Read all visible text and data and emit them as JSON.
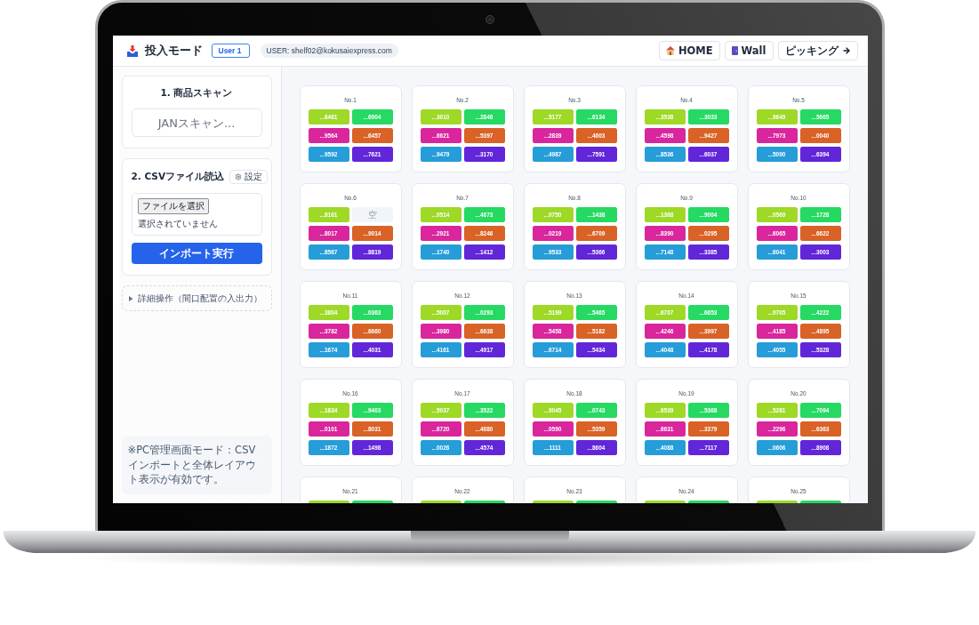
{
  "header": {
    "title": "投入モード",
    "user_badge": "User 1",
    "user_email": "USER: shelf02@kokusaiexpress.com",
    "nav_buttons": [
      {
        "label": "HOME",
        "kind": "home"
      },
      {
        "label": "Wall",
        "kind": "wall"
      },
      {
        "label": "ピッキング",
        "kind": "forward"
      }
    ]
  },
  "sidebar": {
    "scan_panel": {
      "heading": "1. 商品スキャン",
      "input": {
        "placeholder": "JANスキャン..."
      }
    },
    "csv_panel": {
      "heading": "2. CSVファイル読込",
      "settings_button": "設定",
      "file_button": "ファイルを選択",
      "file_status": "選択されていません",
      "import_button": "インポート実行"
    },
    "details": {
      "label": "詳細操作（間口配置の入出力）",
      "expanded": false
    },
    "note": "※PC管理画面モード：CSVインポートと全体レイアウト表示が有効です。"
  },
  "shelves": [
    {
      "label": "No.1",
      "slots": [
        {
          "kind": "filled",
          "text": "...6461",
          "color": "#9dd926"
        },
        {
          "kind": "filled",
          "text": "...6904",
          "color": "#26d962"
        },
        {
          "kind": "filled",
          "text": "...9564",
          "color": "#d9269d"
        },
        {
          "kind": "filled",
          "text": "...6457",
          "color": "#d96226"
        },
        {
          "kind": "filled",
          "text": "...9592",
          "color": "#269dd9"
        },
        {
          "kind": "filled",
          "text": "...7621",
          "color": "#6226d9"
        }
      ]
    },
    {
      "label": "No.2",
      "slots": [
        {
          "kind": "filled",
          "text": "...3010",
          "color": "#9dd926"
        },
        {
          "kind": "filled",
          "text": "...2846",
          "color": "#26d962"
        },
        {
          "kind": "filled",
          "text": "...6621",
          "color": "#d9269d"
        },
        {
          "kind": "filled",
          "text": "...5397",
          "color": "#d96226"
        },
        {
          "kind": "filled",
          "text": "...9479",
          "color": "#269dd9"
        },
        {
          "kind": "filled",
          "text": "...3170",
          "color": "#6226d9"
        }
      ]
    },
    {
      "label": "No.3",
      "slots": [
        {
          "kind": "filled",
          "text": "...5177",
          "color": "#9dd926"
        },
        {
          "kind": "filled",
          "text": "...6134",
          "color": "#26d962"
        },
        {
          "kind": "filled",
          "text": "...2839",
          "color": "#d9269d"
        },
        {
          "kind": "filled",
          "text": "...4603",
          "color": "#d96226"
        },
        {
          "kind": "filled",
          "text": "...4987",
          "color": "#269dd9"
        },
        {
          "kind": "filled",
          "text": "...7591",
          "color": "#6226d9"
        }
      ]
    },
    {
      "label": "No.4",
      "slots": [
        {
          "kind": "filled",
          "text": "...3538",
          "color": "#9dd926"
        },
        {
          "kind": "filled",
          "text": "...3033",
          "color": "#26d962"
        },
        {
          "kind": "filled",
          "text": "...4598",
          "color": "#d9269d"
        },
        {
          "kind": "filled",
          "text": "...9427",
          "color": "#d96226"
        },
        {
          "kind": "filled",
          "text": "...8536",
          "color": "#269dd9"
        },
        {
          "kind": "filled",
          "text": "...6037",
          "color": "#6226d9"
        }
      ]
    },
    {
      "label": "No.5",
      "slots": [
        {
          "kind": "filled",
          "text": "...9649",
          "color": "#9dd926"
        },
        {
          "kind": "filled",
          "text": "...5665",
          "color": "#26d962"
        },
        {
          "kind": "filled",
          "text": "...7973",
          "color": "#d9269d"
        },
        {
          "kind": "filled",
          "text": "...0040",
          "color": "#d96226"
        },
        {
          "kind": "filled",
          "text": "...5090",
          "color": "#269dd9"
        },
        {
          "kind": "filled",
          "text": "...6394",
          "color": "#6226d9"
        }
      ]
    },
    {
      "label": "No.6",
      "slots": [
        {
          "kind": "filled",
          "text": "...8161",
          "color": "#9dd926"
        },
        {
          "kind": "empty",
          "text": "空"
        },
        {
          "kind": "filled",
          "text": "...8017",
          "color": "#d9269d"
        },
        {
          "kind": "filled",
          "text": "...9014",
          "color": "#d96226"
        },
        {
          "kind": "filled",
          "text": "...8567",
          "color": "#269dd9"
        },
        {
          "kind": "filled",
          "text": "...8819",
          "color": "#6226d9"
        }
      ]
    },
    {
      "label": "No.7",
      "slots": [
        {
          "kind": "filled",
          "text": "...0514",
          "color": "#9dd926"
        },
        {
          "kind": "filled",
          "text": "...4673",
          "color": "#26d962"
        },
        {
          "kind": "filled",
          "text": "...2921",
          "color": "#d9269d"
        },
        {
          "kind": "filled",
          "text": "...8246",
          "color": "#d96226"
        },
        {
          "kind": "filled",
          "text": "...1740",
          "color": "#269dd9"
        },
        {
          "kind": "filled",
          "text": "...1412",
          "color": "#6226d9"
        }
      ]
    },
    {
      "label": "No.8",
      "slots": [
        {
          "kind": "filled",
          "text": "...0750",
          "color": "#9dd926"
        },
        {
          "kind": "filled",
          "text": "...1438",
          "color": "#26d962"
        },
        {
          "kind": "filled",
          "text": "...0219",
          "color": "#d9269d"
        },
        {
          "kind": "filled",
          "text": "...6709",
          "color": "#d96226"
        },
        {
          "kind": "filled",
          "text": "...9533",
          "color": "#269dd9"
        },
        {
          "kind": "filled",
          "text": "...5366",
          "color": "#6226d9"
        }
      ]
    },
    {
      "label": "No.9",
      "slots": [
        {
          "kind": "filled",
          "text": "...1368",
          "color": "#9dd926"
        },
        {
          "kind": "filled",
          "text": "...9004",
          "color": "#26d962"
        },
        {
          "kind": "filled",
          "text": "...8390",
          "color": "#d9269d"
        },
        {
          "kind": "filled",
          "text": "...0295",
          "color": "#d96226"
        },
        {
          "kind": "filled",
          "text": "...7148",
          "color": "#269dd9"
        },
        {
          "kind": "filled",
          "text": "...3385",
          "color": "#6226d9"
        }
      ]
    },
    {
      "label": "No.10",
      "slots": [
        {
          "kind": "filled",
          "text": "...0569",
          "color": "#9dd926"
        },
        {
          "kind": "filled",
          "text": "...1728",
          "color": "#26d962"
        },
        {
          "kind": "filled",
          "text": "...6065",
          "color": "#d9269d"
        },
        {
          "kind": "filled",
          "text": "...6622",
          "color": "#d96226"
        },
        {
          "kind": "filled",
          "text": "...6041",
          "color": "#269dd9"
        },
        {
          "kind": "filled",
          "text": "...3003",
          "color": "#6226d9"
        }
      ]
    },
    {
      "label": "No.11",
      "slots": [
        {
          "kind": "filled",
          "text": "...3804",
          "color": "#9dd926"
        },
        {
          "kind": "filled",
          "text": "...0363",
          "color": "#26d962"
        },
        {
          "kind": "filled",
          "text": "...3782",
          "color": "#d9269d"
        },
        {
          "kind": "filled",
          "text": "...6660",
          "color": "#d96226"
        },
        {
          "kind": "filled",
          "text": "...1674",
          "color": "#269dd9"
        },
        {
          "kind": "filled",
          "text": "...4031",
          "color": "#6226d9"
        }
      ]
    },
    {
      "label": "No.12",
      "slots": [
        {
          "kind": "filled",
          "text": "...5007",
          "color": "#9dd926"
        },
        {
          "kind": "filled",
          "text": "...0293",
          "color": "#26d962"
        },
        {
          "kind": "filled",
          "text": "...3980",
          "color": "#d9269d"
        },
        {
          "kind": "filled",
          "text": "...6638",
          "color": "#d96226"
        },
        {
          "kind": "filled",
          "text": "...4161",
          "color": "#269dd9"
        },
        {
          "kind": "filled",
          "text": "...4917",
          "color": "#6226d9"
        }
      ]
    },
    {
      "label": "No.13",
      "slots": [
        {
          "kind": "filled",
          "text": "...5199",
          "color": "#9dd926"
        },
        {
          "kind": "filled",
          "text": "...5465",
          "color": "#26d962"
        },
        {
          "kind": "filled",
          "text": "...5458",
          "color": "#d9269d"
        },
        {
          "kind": "filled",
          "text": "...5182",
          "color": "#d96226"
        },
        {
          "kind": "filled",
          "text": "...6714",
          "color": "#269dd9"
        },
        {
          "kind": "filled",
          "text": "...5434",
          "color": "#6226d9"
        }
      ]
    },
    {
      "label": "No.14",
      "slots": [
        {
          "kind": "filled",
          "text": "...6707",
          "color": "#9dd926"
        },
        {
          "kind": "filled",
          "text": "...6653",
          "color": "#26d962"
        },
        {
          "kind": "filled",
          "text": "...4246",
          "color": "#d9269d"
        },
        {
          "kind": "filled",
          "text": "...3997",
          "color": "#d96226"
        },
        {
          "kind": "filled",
          "text": "...4048",
          "color": "#269dd9"
        },
        {
          "kind": "filled",
          "text": "...4178",
          "color": "#6226d9"
        }
      ]
    },
    {
      "label": "No.15",
      "slots": [
        {
          "kind": "filled",
          "text": "...0705",
          "color": "#9dd926"
        },
        {
          "kind": "filled",
          "text": "...4222",
          "color": "#26d962"
        },
        {
          "kind": "filled",
          "text": "...4185",
          "color": "#d9269d"
        },
        {
          "kind": "filled",
          "text": "...4895",
          "color": "#d96226"
        },
        {
          "kind": "filled",
          "text": "...4055",
          "color": "#269dd9"
        },
        {
          "kind": "filled",
          "text": "...5328",
          "color": "#6226d9"
        }
      ]
    },
    {
      "label": "No.16",
      "slots": [
        {
          "kind": "filled",
          "text": "...1834",
          "color": "#9dd926"
        },
        {
          "kind": "filled",
          "text": "...9403",
          "color": "#26d962"
        },
        {
          "kind": "filled",
          "text": "...0101",
          "color": "#d9269d"
        },
        {
          "kind": "filled",
          "text": "...8031",
          "color": "#d96226"
        },
        {
          "kind": "filled",
          "text": "...1872",
          "color": "#269dd9"
        },
        {
          "kind": "filled",
          "text": "...1498",
          "color": "#6226d9"
        }
      ]
    },
    {
      "label": "No.17",
      "slots": [
        {
          "kind": "filled",
          "text": "...5037",
          "color": "#9dd926"
        },
        {
          "kind": "filled",
          "text": "...3522",
          "color": "#26d962"
        },
        {
          "kind": "filled",
          "text": "...6720",
          "color": "#d9269d"
        },
        {
          "kind": "filled",
          "text": "...4680",
          "color": "#d96226"
        },
        {
          "kind": "filled",
          "text": "...0026",
          "color": "#269dd9"
        },
        {
          "kind": "filled",
          "text": "...4574",
          "color": "#6226d9"
        }
      ]
    },
    {
      "label": "No.18",
      "slots": [
        {
          "kind": "filled",
          "text": "...9045",
          "color": "#9dd926"
        },
        {
          "kind": "filled",
          "text": "...0743",
          "color": "#26d962"
        },
        {
          "kind": "filled",
          "text": "...0590",
          "color": "#d9269d"
        },
        {
          "kind": "filled",
          "text": "...5359",
          "color": "#d96226"
        },
        {
          "kind": "filled",
          "text": "...1111",
          "color": "#269dd9"
        },
        {
          "kind": "filled",
          "text": "...8604",
          "color": "#6226d9"
        }
      ]
    },
    {
      "label": "No.19",
      "slots": [
        {
          "kind": "filled",
          "text": "...6539",
          "color": "#9dd926"
        },
        {
          "kind": "filled",
          "text": "...5368",
          "color": "#26d962"
        },
        {
          "kind": "filled",
          "text": "...6631",
          "color": "#d9269d"
        },
        {
          "kind": "filled",
          "text": "...3379",
          "color": "#d96226"
        },
        {
          "kind": "filled",
          "text": "...4088",
          "color": "#269dd9"
        },
        {
          "kind": "filled",
          "text": "...7117",
          "color": "#6226d9"
        }
      ]
    },
    {
      "label": "No.20",
      "slots": [
        {
          "kind": "filled",
          "text": "...5281",
          "color": "#9dd926"
        },
        {
          "kind": "filled",
          "text": "...7094",
          "color": "#26d962"
        },
        {
          "kind": "filled",
          "text": "...2296",
          "color": "#d9269d"
        },
        {
          "kind": "filled",
          "text": "...6363",
          "color": "#d96226"
        },
        {
          "kind": "filled",
          "text": "...0606",
          "color": "#269dd9"
        },
        {
          "kind": "filled",
          "text": "...8908",
          "color": "#6226d9"
        }
      ]
    },
    {
      "label": "No.21",
      "slots": [
        {
          "kind": "filled",
          "color": "#9dd926"
        },
        {
          "kind": "filled",
          "color": "#26d962"
        }
      ]
    },
    {
      "label": "No.22",
      "slots": [
        {
          "kind": "filled",
          "color": "#9dd926"
        },
        {
          "kind": "filled",
          "color": "#26d962"
        }
      ]
    },
    {
      "label": "No.23",
      "slots": [
        {
          "kind": "filled",
          "color": "#9dd926"
        },
        {
          "kind": "filled",
          "color": "#26d962"
        }
      ]
    },
    {
      "label": "No.24",
      "slots": [
        {
          "kind": "filled",
          "color": "#9dd926"
        },
        {
          "kind": "filled",
          "color": "#26d962"
        }
      ]
    },
    {
      "label": "No.25",
      "slots": [
        {
          "kind": "filled",
          "color": "#9dd926"
        },
        {
          "kind": "filled",
          "color": "#26d962"
        }
      ]
    }
  ]
}
